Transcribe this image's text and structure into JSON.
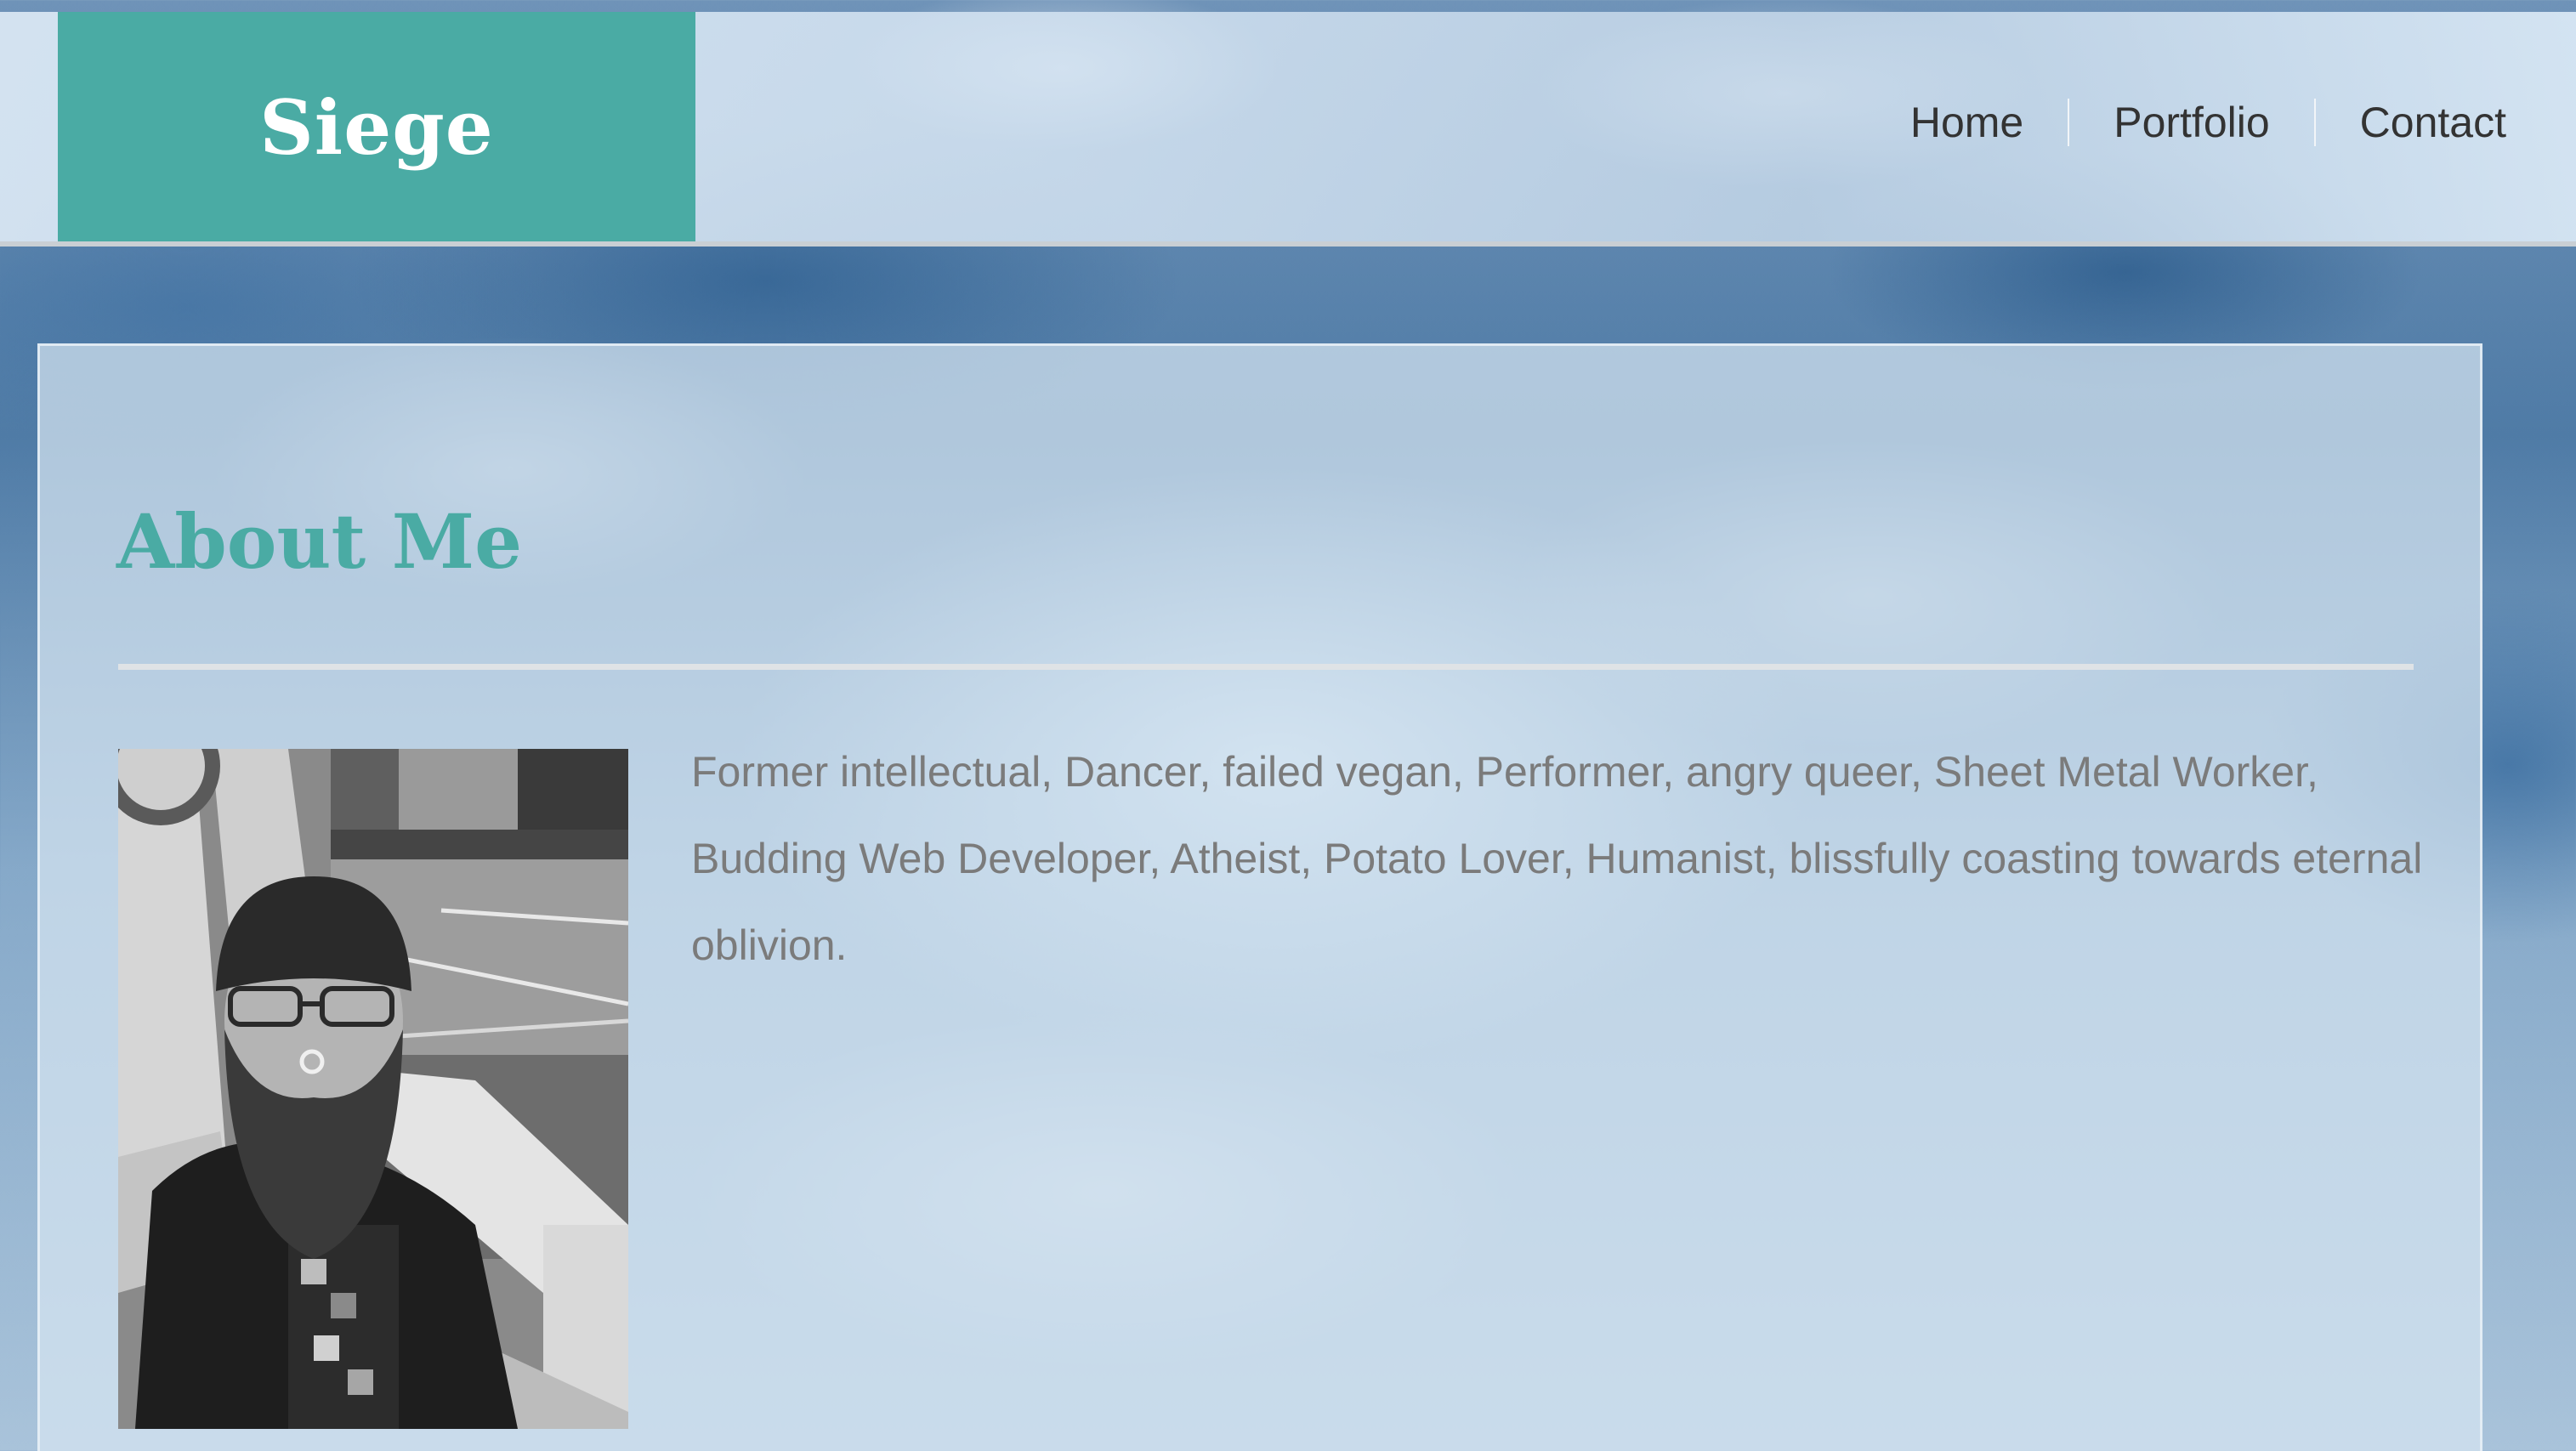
{
  "header": {
    "logo": "Siege",
    "nav": [
      {
        "label": "Home"
      },
      {
        "label": "Portfolio"
      },
      {
        "label": "Contact"
      }
    ]
  },
  "about": {
    "title": "About Me",
    "bio": "Former intellectual, Dancer, failed vegan, Performer, angry queer, Sheet Metal Worker, Budding Web Developer, Atheist, Potato Lover, Humanist, blissfully coasting towards eternal oblivion.",
    "photo_icon": "profile-photo"
  },
  "colors": {
    "accent": "#4aaba4",
    "nav_text": "#333333",
    "body_text": "#7b7b7b"
  }
}
